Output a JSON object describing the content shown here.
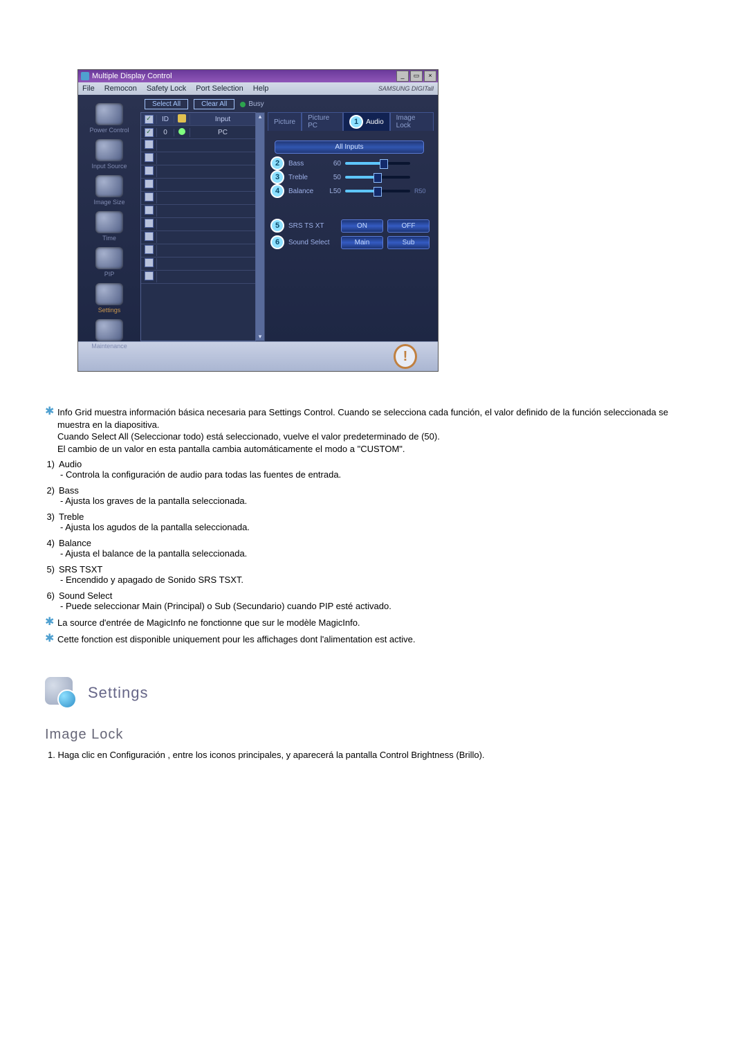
{
  "window": {
    "title": "Multiple Display Control"
  },
  "menubar": {
    "items": [
      "File",
      "Remocon",
      "Safety Lock",
      "Port Selection",
      "Help"
    ],
    "brand": "SAMSUNG DIGITall"
  },
  "sidebar": {
    "items": [
      {
        "label": "Power Control"
      },
      {
        "label": "Input Source"
      },
      {
        "label": "Image Size"
      },
      {
        "label": "Time"
      },
      {
        "label": "PIP"
      },
      {
        "label": "Settings",
        "active": true
      },
      {
        "label": "Maintenance"
      }
    ]
  },
  "top_controls": {
    "select_all": "Select All",
    "clear_all": "Clear All",
    "busy": "Busy"
  },
  "grid": {
    "headers": {
      "id": "ID",
      "input": "Input"
    },
    "first_row": {
      "id": "0",
      "input": "PC"
    }
  },
  "tabs": {
    "picture": "Picture",
    "picture_pc": "Picture PC",
    "audio": "Audio",
    "image_lock": "Image Lock"
  },
  "panel": {
    "all_inputs": "All Inputs",
    "bass": {
      "label": "Bass",
      "value": "60",
      "fill": "60%"
    },
    "treble": {
      "label": "Treble",
      "value": "50",
      "fill": "50%"
    },
    "balance": {
      "label": "Balance",
      "left": "L50",
      "right": "R50",
      "fill": "50%"
    },
    "srs": {
      "label": "SRS TS XT",
      "on": "ON",
      "off": "OFF"
    },
    "sound_select": {
      "label": "Sound Select",
      "main": "Main",
      "sub": "Sub"
    }
  },
  "callouts": {
    "c1": "1",
    "c2": "2",
    "c3": "3",
    "c4": "4",
    "c5": "5",
    "c6": "6"
  },
  "text": {
    "star1": "Info Grid muestra información básica necesaria para Settings Control. Cuando se selecciona cada función, el valor definido de la función seleccionada se muestra en la diapositiva.\nCuando Select All (Seleccionar todo) está seleccionado, vuelve el valor predeterminado de (50).\nEl cambio de un valor en esta pantalla cambia automáticamente el modo a \"CUSTOM\".",
    "l1": {
      "n": "1)",
      "t": "Audio",
      "s": "- Controla la configuración de audio para todas las fuentes de entrada."
    },
    "l2": {
      "n": "2)",
      "t": "Bass",
      "s": "- Ajusta los graves de la pantalla seleccionada."
    },
    "l3": {
      "n": "3)",
      "t": "Treble",
      "s": "- Ajusta los agudos de la pantalla seleccionada."
    },
    "l4": {
      "n": "4)",
      "t": "Balance",
      "s": "- Ajusta el balance de la pantalla seleccionada."
    },
    "l5": {
      "n": "5)",
      "t": "SRS TSXT",
      "s": "- Encendido y apagado de Sonido SRS TSXT."
    },
    "l6": {
      "n": "6)",
      "t": "Sound Select",
      "s": "- Puede seleccionar Main (Principal) o Sub (Secundario) cuando PIP esté activado."
    },
    "star2": "La source d'entrée de MagicInfo ne fonctionne que sur le modèle MagicInfo.",
    "star3": "Cette fonction est disponible uniquement pour les affichages dont l'alimentation est active.",
    "settings_title": "Settings",
    "sub_title": "Image Lock",
    "sub_step": "1.  Haga clic en Configuración , entre los iconos principales, y aparecerá la pantalla Control Brightness (Brillo)."
  }
}
